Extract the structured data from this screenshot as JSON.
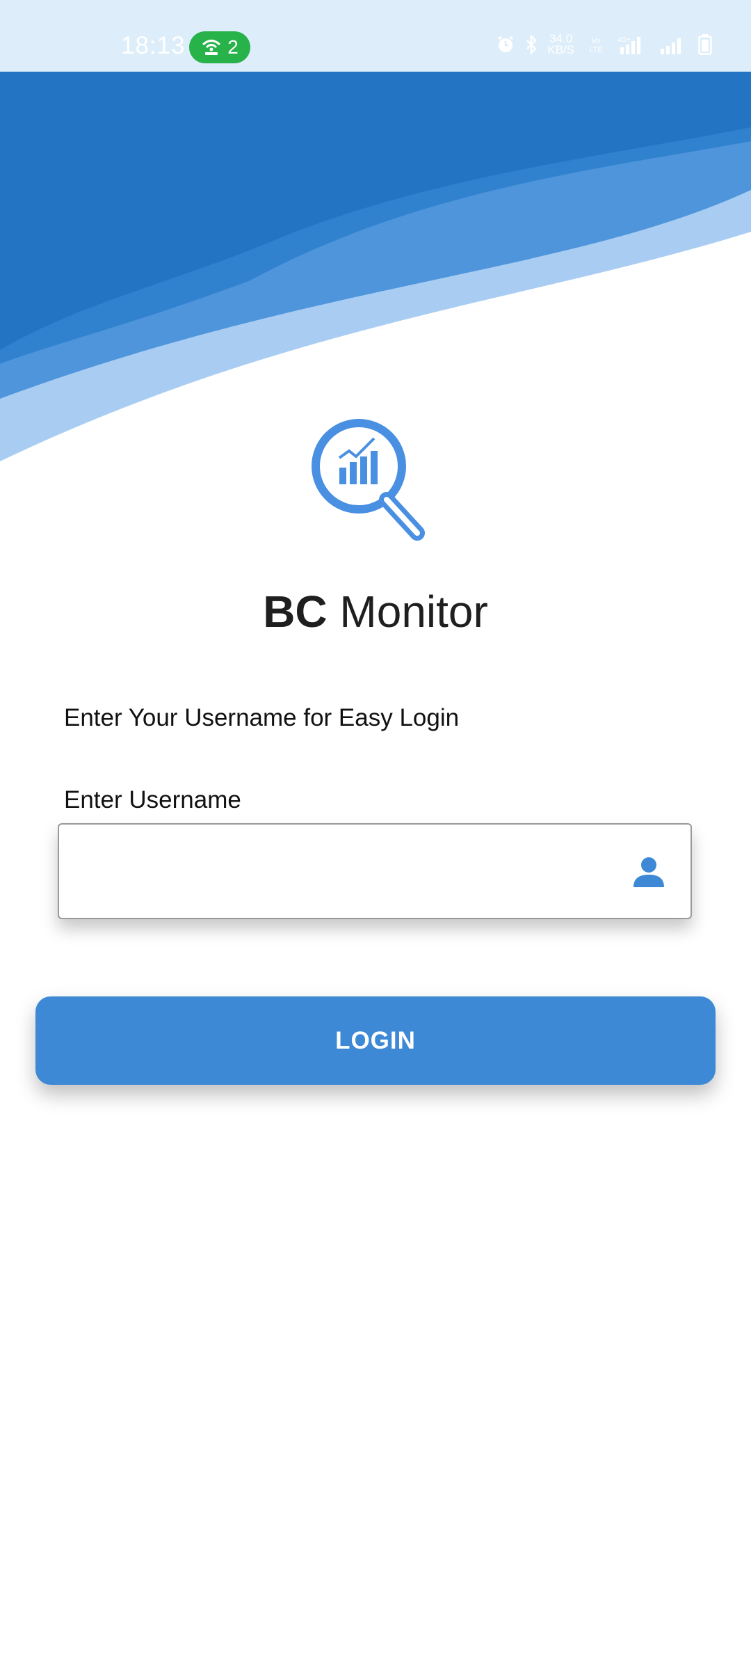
{
  "status_bar": {
    "time": "18:13",
    "hotspot_count": "2",
    "net_speed_value": "34.0",
    "net_speed_unit": "KB/S",
    "sim1_label": "VoLTE",
    "sim2_label": "VoLTE"
  },
  "brand": {
    "name_bold": "BC",
    "name_regular": "Monitor"
  },
  "login": {
    "subtitle": "Enter Your Username for Easy Login",
    "username_label": "Enter Username",
    "username_value": "",
    "username_placeholder": "",
    "button_label": "LOGIN"
  },
  "colors": {
    "primary": "#3d89d6",
    "header_blue": "#2474c4",
    "status_bar_bg": "#ddeefa",
    "hotspot_green": "#27b24a"
  }
}
